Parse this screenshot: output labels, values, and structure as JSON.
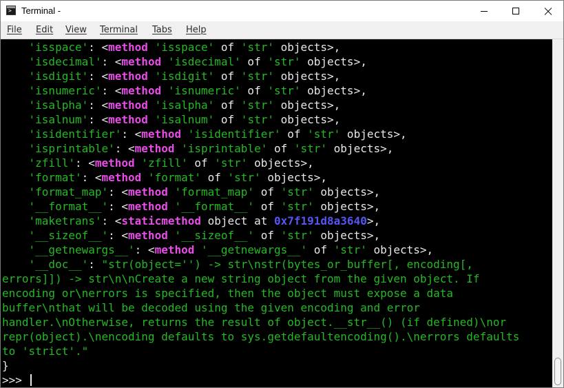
{
  "window": {
    "title": "Terminal -"
  },
  "menu": [
    "File",
    "Edit",
    "View",
    "Terminal",
    "Tabs",
    "Help"
  ],
  "colors": {
    "terminal_background": "#000000",
    "string_literal": "#25b825",
    "keyword": "#e94ce9",
    "address": "#5656f6",
    "punctuation": "#e8e8e8"
  },
  "terminal": {
    "lines": [
      [
        {
          "t": "    'isspace'",
          "c": "str"
        },
        {
          "t": ": <",
          "c": "punct"
        },
        {
          "t": "method",
          "c": "kw"
        },
        {
          "t": " 'isspace'",
          "c": "str"
        },
        {
          "t": " of",
          "c": "punct"
        },
        {
          "t": " 'str'",
          "c": "str"
        },
        {
          "t": " objects>,",
          "c": "punct"
        }
      ],
      [
        {
          "t": "    'isdecimal'",
          "c": "str"
        },
        {
          "t": ": <",
          "c": "punct"
        },
        {
          "t": "method",
          "c": "kw"
        },
        {
          "t": " 'isdecimal'",
          "c": "str"
        },
        {
          "t": " of",
          "c": "punct"
        },
        {
          "t": " 'str'",
          "c": "str"
        },
        {
          "t": " objects>,",
          "c": "punct"
        }
      ],
      [
        {
          "t": "    'isdigit'",
          "c": "str"
        },
        {
          "t": ": <",
          "c": "punct"
        },
        {
          "t": "method",
          "c": "kw"
        },
        {
          "t": " 'isdigit'",
          "c": "str"
        },
        {
          "t": " of",
          "c": "punct"
        },
        {
          "t": " 'str'",
          "c": "str"
        },
        {
          "t": " objects>,",
          "c": "punct"
        }
      ],
      [
        {
          "t": "    'isnumeric'",
          "c": "str"
        },
        {
          "t": ": <",
          "c": "punct"
        },
        {
          "t": "method",
          "c": "kw"
        },
        {
          "t": " 'isnumeric'",
          "c": "str"
        },
        {
          "t": " of",
          "c": "punct"
        },
        {
          "t": " 'str'",
          "c": "str"
        },
        {
          "t": " objects>,",
          "c": "punct"
        }
      ],
      [
        {
          "t": "    'isalpha'",
          "c": "str"
        },
        {
          "t": ": <",
          "c": "punct"
        },
        {
          "t": "method",
          "c": "kw"
        },
        {
          "t": " 'isalpha'",
          "c": "str"
        },
        {
          "t": " of",
          "c": "punct"
        },
        {
          "t": " 'str'",
          "c": "str"
        },
        {
          "t": " objects>,",
          "c": "punct"
        }
      ],
      [
        {
          "t": "    'isalnum'",
          "c": "str"
        },
        {
          "t": ": <",
          "c": "punct"
        },
        {
          "t": "method",
          "c": "kw"
        },
        {
          "t": " 'isalnum'",
          "c": "str"
        },
        {
          "t": " of",
          "c": "punct"
        },
        {
          "t": " 'str'",
          "c": "str"
        },
        {
          "t": " objects>,",
          "c": "punct"
        }
      ],
      [
        {
          "t": "    'isidentifier'",
          "c": "str"
        },
        {
          "t": ": <",
          "c": "punct"
        },
        {
          "t": "method",
          "c": "kw"
        },
        {
          "t": " 'isidentifier'",
          "c": "str"
        },
        {
          "t": " of",
          "c": "punct"
        },
        {
          "t": " 'str'",
          "c": "str"
        },
        {
          "t": " objects>,",
          "c": "punct"
        }
      ],
      [
        {
          "t": "    'isprintable'",
          "c": "str"
        },
        {
          "t": ": <",
          "c": "punct"
        },
        {
          "t": "method",
          "c": "kw"
        },
        {
          "t": " 'isprintable'",
          "c": "str"
        },
        {
          "t": " of",
          "c": "punct"
        },
        {
          "t": " 'str'",
          "c": "str"
        },
        {
          "t": " objects>,",
          "c": "punct"
        }
      ],
      [
        {
          "t": "    'zfill'",
          "c": "str"
        },
        {
          "t": ": <",
          "c": "punct"
        },
        {
          "t": "method",
          "c": "kw"
        },
        {
          "t": " 'zfill'",
          "c": "str"
        },
        {
          "t": " of",
          "c": "punct"
        },
        {
          "t": " 'str'",
          "c": "str"
        },
        {
          "t": " objects>,",
          "c": "punct"
        }
      ],
      [
        {
          "t": "    'format'",
          "c": "str"
        },
        {
          "t": ": <",
          "c": "punct"
        },
        {
          "t": "method",
          "c": "kw"
        },
        {
          "t": " 'format'",
          "c": "str"
        },
        {
          "t": " of",
          "c": "punct"
        },
        {
          "t": " 'str'",
          "c": "str"
        },
        {
          "t": " objects>,",
          "c": "punct"
        }
      ],
      [
        {
          "t": "    'format_map'",
          "c": "str"
        },
        {
          "t": ": <",
          "c": "punct"
        },
        {
          "t": "method",
          "c": "kw"
        },
        {
          "t": " 'format_map'",
          "c": "str"
        },
        {
          "t": " of",
          "c": "punct"
        },
        {
          "t": " 'str'",
          "c": "str"
        },
        {
          "t": " objects>,",
          "c": "punct"
        }
      ],
      [
        {
          "t": "    '__format__'",
          "c": "str"
        },
        {
          "t": ": <",
          "c": "punct"
        },
        {
          "t": "method",
          "c": "kw"
        },
        {
          "t": " '__format__'",
          "c": "str"
        },
        {
          "t": " of",
          "c": "punct"
        },
        {
          "t": " 'str'",
          "c": "str"
        },
        {
          "t": " objects>,",
          "c": "punct"
        }
      ],
      [
        {
          "t": "    'maketrans'",
          "c": "str"
        },
        {
          "t": ": <",
          "c": "punct"
        },
        {
          "t": "staticmethod",
          "c": "kw"
        },
        {
          "t": " object at ",
          "c": "punct"
        },
        {
          "t": "0x7f191d8a3640",
          "c": "num"
        },
        {
          "t": ">,",
          "c": "punct"
        }
      ],
      [
        {
          "t": "    '__sizeof__'",
          "c": "str"
        },
        {
          "t": ": <",
          "c": "punct"
        },
        {
          "t": "method",
          "c": "kw"
        },
        {
          "t": " '__sizeof__'",
          "c": "str"
        },
        {
          "t": " of",
          "c": "punct"
        },
        {
          "t": " 'str'",
          "c": "str"
        },
        {
          "t": " objects>,",
          "c": "punct"
        }
      ],
      [
        {
          "t": "    '__getnewargs__'",
          "c": "str"
        },
        {
          "t": ": <",
          "c": "punct"
        },
        {
          "t": "method",
          "c": "kw"
        },
        {
          "t": " '__getnewargs__'",
          "c": "str"
        },
        {
          "t": " of",
          "c": "punct"
        },
        {
          "t": " 'str'",
          "c": "str"
        },
        {
          "t": " objects>,",
          "c": "punct"
        }
      ],
      [
        {
          "t": "    '__doc__'",
          "c": "str"
        },
        {
          "t": ": ",
          "c": "punct"
        },
        {
          "t": "\"str(object='') -> str\\nstr(bytes_or_buffer[, encoding[,",
          "c": "str"
        }
      ],
      [
        {
          "t": "errors]]) -> str\\n\\nCreate a new string object from the given object. If",
          "c": "str"
        }
      ],
      [
        {
          "t": "encoding or\\nerrors is specified, then the object must expose a data",
          "c": "str"
        }
      ],
      [
        {
          "t": "buffer\\nthat will be decoded using the given encoding and error",
          "c": "str"
        }
      ],
      [
        {
          "t": "handler.\\nOtherwise, returns the result of object.__str__() (if defined)\\nor",
          "c": "str"
        }
      ],
      [
        {
          "t": "repr(object).\\nencoding defaults to sys.getdefaultencoding().\\nerrors defaults",
          "c": "str"
        }
      ],
      [
        {
          "t": "to 'strict'.\"",
          "c": "str"
        }
      ],
      [
        {
          "t": "}",
          "c": "punct"
        }
      ]
    ],
    "prompt": ">>> "
  },
  "scrollbar": {
    "position_fraction": 1.0
  }
}
